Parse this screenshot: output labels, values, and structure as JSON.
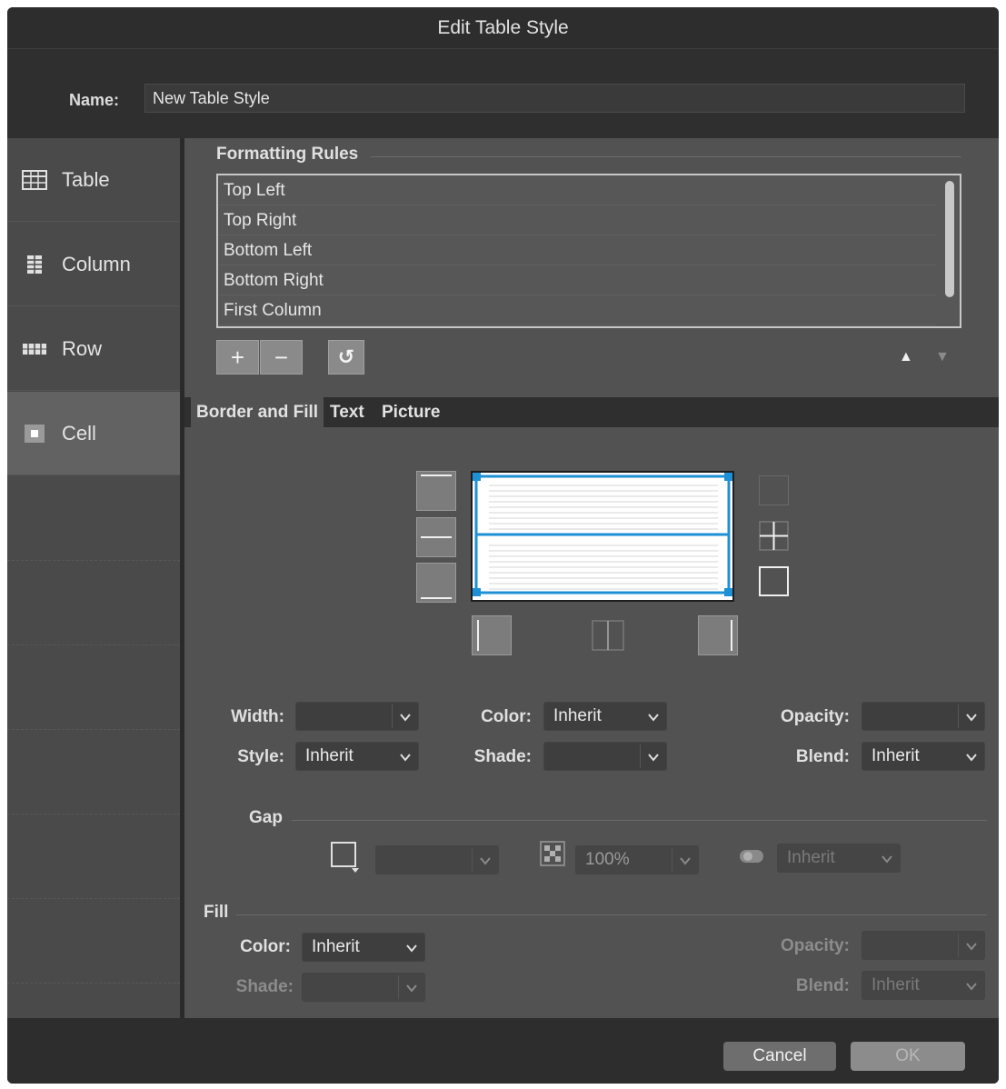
{
  "window": {
    "title": "Edit Table Style"
  },
  "name_field": {
    "label": "Name:",
    "value": "New Table Style"
  },
  "sidebar": {
    "items": [
      {
        "label": "Table",
        "icon": "table-icon"
      },
      {
        "label": "Column",
        "icon": "column-icon"
      },
      {
        "label": "Row",
        "icon": "row-icon"
      },
      {
        "label": "Cell",
        "icon": "cell-icon",
        "active": true
      }
    ]
  },
  "formatting_rules": {
    "title": "Formatting Rules",
    "items": [
      "Top Left",
      "Top Right",
      "Bottom Left",
      "Bottom Right",
      "First Column"
    ],
    "add_label": "+",
    "remove_label": "−",
    "reset_label": "↺",
    "move_up_label": "▲",
    "move_down_label": "▼"
  },
  "tabs": [
    {
      "label": "Border and Fill",
      "active": true
    },
    {
      "label": "Text"
    },
    {
      "label": "Picture"
    }
  ],
  "border": {
    "width_label": "Width:",
    "width_value": "",
    "color_label": "Color:",
    "color_value": "Inherit",
    "opacity_label": "Opacity:",
    "opacity_value": "",
    "style_label": "Style:",
    "style_value": "Inherit",
    "shade_label": "Shade:",
    "shade_value": "",
    "blend_label": "Blend:",
    "blend_value": "Inherit"
  },
  "gap": {
    "title": "Gap",
    "size_value": "",
    "percent_value": "100%",
    "inherit_value": "Inherit"
  },
  "fill": {
    "title": "Fill",
    "color_label": "Color:",
    "color_value": "Inherit",
    "shade_label": "Shade:",
    "shade_value": "",
    "opacity_label": "Opacity:",
    "opacity_value": "",
    "blend_label": "Blend:",
    "blend_value": "Inherit"
  },
  "footer": {
    "cancel_label": "Cancel",
    "ok_label": "OK"
  },
  "colors": {
    "accent": "#1e90d6",
    "window_bg": "#2f2f2f",
    "panel_bg": "#525252",
    "sidebar_bg": "#4a4a4a"
  }
}
